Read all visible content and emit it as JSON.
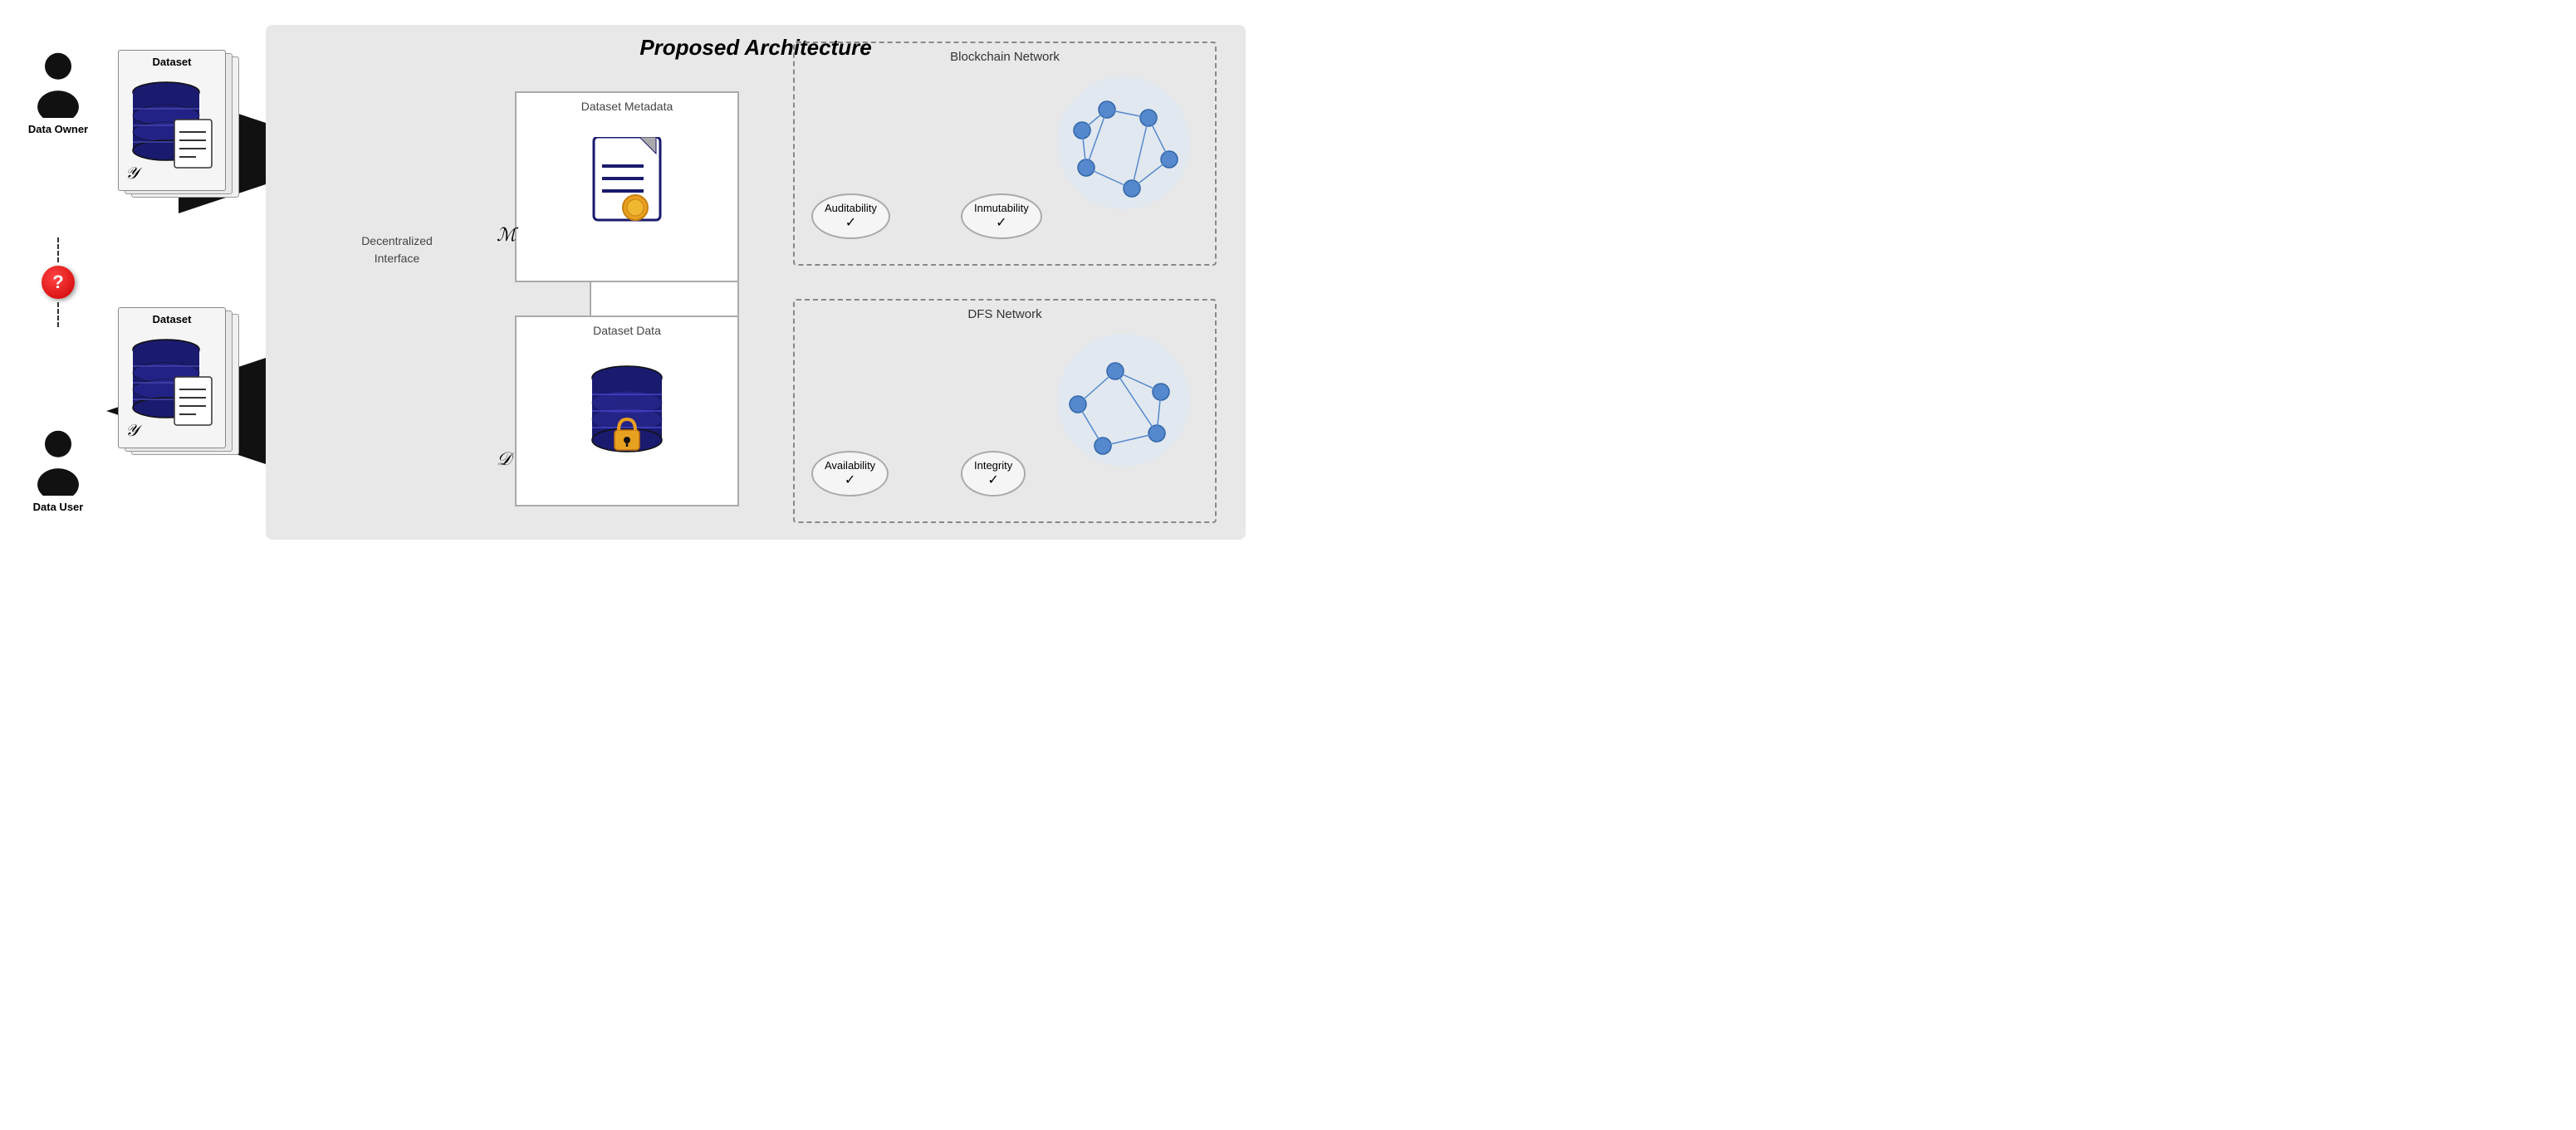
{
  "title": "Proposed Architecture",
  "people": {
    "data_owner": {
      "label": "Data Owner",
      "role": "owner"
    },
    "data_user": {
      "label": "Data User",
      "role": "user"
    },
    "question_mark": "?"
  },
  "datasets": {
    "top": {
      "title": "Dataset",
      "math_label": "𝒴"
    },
    "bottom": {
      "title": "Dataset",
      "math_label": "𝒴"
    }
  },
  "interface": {
    "label": "Decentralized\nInterface"
  },
  "components": {
    "metadata": {
      "title": "Dataset Metadata",
      "math_label": "ℳ"
    },
    "data": {
      "title": "Dataset Data",
      "math_label": "𝒟"
    }
  },
  "networks": {
    "blockchain": {
      "title": "Blockchain Network",
      "properties": [
        {
          "label": "Auditability",
          "check": "✓"
        },
        {
          "label": "Inmutability",
          "check": "✓"
        }
      ]
    },
    "dfs": {
      "title": "DFS Network",
      "properties": [
        {
          "label": "Availability",
          "check": "✓"
        },
        {
          "label": "Integrity",
          "check": "✓"
        }
      ]
    }
  }
}
